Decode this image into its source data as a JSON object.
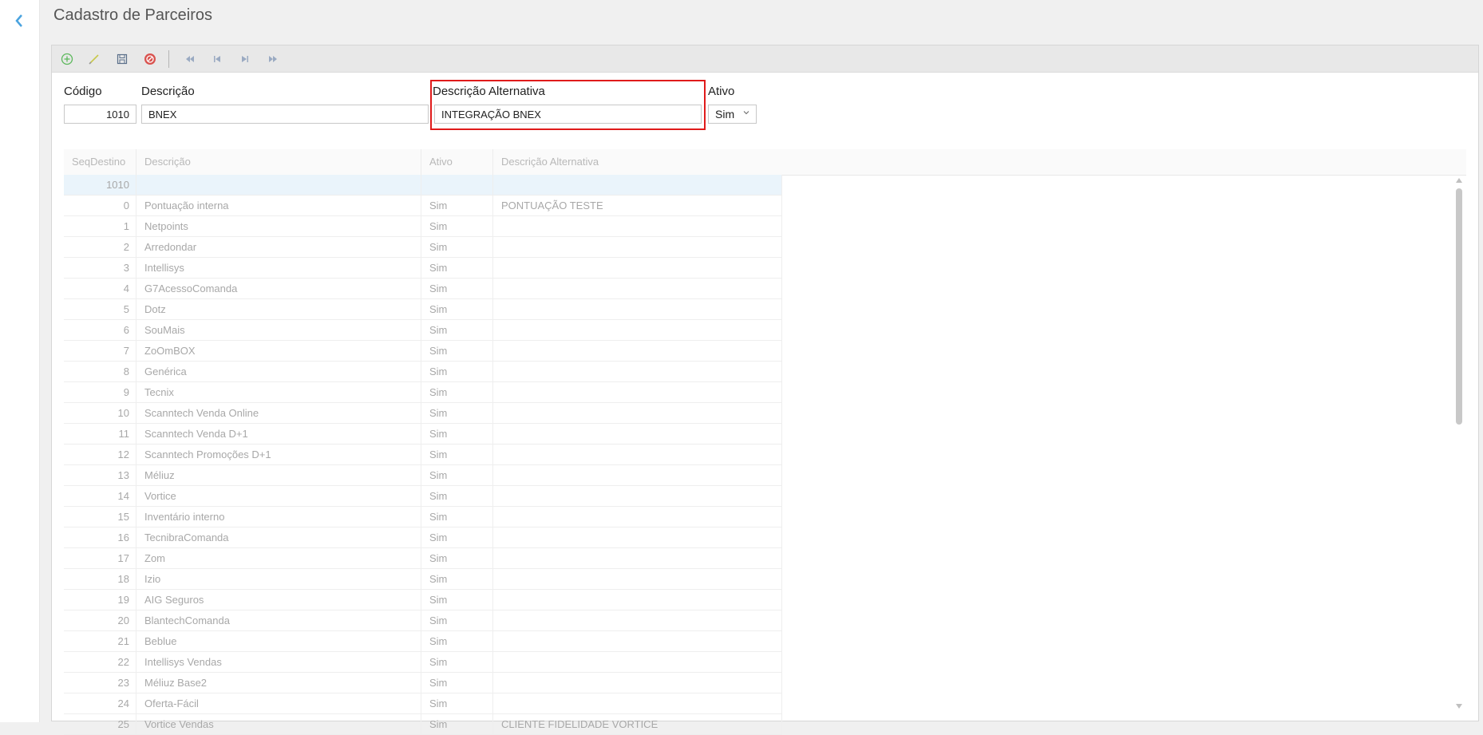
{
  "page": {
    "title": "Cadastro de Parceiros"
  },
  "icons": {
    "back": "chevron-left-icon",
    "toolbar": [
      "add-icon",
      "edit-icon",
      "save-icon",
      "cancel-icon",
      "first-icon",
      "previous-icon",
      "next-icon",
      "last-icon"
    ]
  },
  "colors": {
    "accent": "#4aa3df",
    "highlight": "#e01b1b",
    "add": "#5cb85c",
    "cancel": "#d9534f"
  },
  "form": {
    "codigo": {
      "label": "Código",
      "value": "1010"
    },
    "descricao": {
      "label": "Descrição",
      "value": "BNEX"
    },
    "descricao_alternativa": {
      "label": "Descrição Alternativa",
      "value": "INTEGRAÇÃO BNEX"
    },
    "ativo": {
      "label": "Ativo",
      "value": "Sim"
    }
  },
  "grid": {
    "columns": [
      "SeqDestino",
      "Descrição",
      "Ativo",
      "Descrição Alternativa"
    ],
    "rows": [
      {
        "seq": "1010",
        "desc": "",
        "ativo": "",
        "alt": ""
      },
      {
        "seq": "0",
        "desc": "Pontuação interna",
        "ativo": "Sim",
        "alt": "PONTUAÇÃO TESTE"
      },
      {
        "seq": "1",
        "desc": "Netpoints",
        "ativo": "Sim",
        "alt": ""
      },
      {
        "seq": "2",
        "desc": "Arredondar",
        "ativo": "Sim",
        "alt": ""
      },
      {
        "seq": "3",
        "desc": "Intellisys",
        "ativo": "Sim",
        "alt": ""
      },
      {
        "seq": "4",
        "desc": "G7AcessoComanda",
        "ativo": "Sim",
        "alt": ""
      },
      {
        "seq": "5",
        "desc": "Dotz",
        "ativo": "Sim",
        "alt": ""
      },
      {
        "seq": "6",
        "desc": "SouMais",
        "ativo": "Sim",
        "alt": ""
      },
      {
        "seq": "7",
        "desc": "ZoOmBOX",
        "ativo": "Sim",
        "alt": ""
      },
      {
        "seq": "8",
        "desc": "Genérica",
        "ativo": "Sim",
        "alt": ""
      },
      {
        "seq": "9",
        "desc": "Tecnix",
        "ativo": "Sim",
        "alt": ""
      },
      {
        "seq": "10",
        "desc": "Scanntech Venda Online",
        "ativo": "Sim",
        "alt": ""
      },
      {
        "seq": "11",
        "desc": "Scanntech Venda D+1",
        "ativo": "Sim",
        "alt": ""
      },
      {
        "seq": "12",
        "desc": "Scanntech Promoções D+1",
        "ativo": "Sim",
        "alt": ""
      },
      {
        "seq": "13",
        "desc": "Méliuz",
        "ativo": "Sim",
        "alt": ""
      },
      {
        "seq": "14",
        "desc": "Vortice",
        "ativo": "Sim",
        "alt": ""
      },
      {
        "seq": "15",
        "desc": "Inventário interno",
        "ativo": "Sim",
        "alt": ""
      },
      {
        "seq": "16",
        "desc": "TecnibraComanda",
        "ativo": "Sim",
        "alt": ""
      },
      {
        "seq": "17",
        "desc": "Zom",
        "ativo": "Sim",
        "alt": ""
      },
      {
        "seq": "18",
        "desc": "Izio",
        "ativo": "Sim",
        "alt": ""
      },
      {
        "seq": "19",
        "desc": "AIG Seguros",
        "ativo": "Sim",
        "alt": ""
      },
      {
        "seq": "20",
        "desc": "BlantechComanda",
        "ativo": "Sim",
        "alt": ""
      },
      {
        "seq": "21",
        "desc": "Beblue",
        "ativo": "Sim",
        "alt": ""
      },
      {
        "seq": "22",
        "desc": "Intellisys Vendas",
        "ativo": "Sim",
        "alt": ""
      },
      {
        "seq": "23",
        "desc": "Méliuz Base2",
        "ativo": "Sim",
        "alt": ""
      },
      {
        "seq": "24",
        "desc": "Oferta-Fácil",
        "ativo": "Sim",
        "alt": ""
      },
      {
        "seq": "25",
        "desc": "Vortice Vendas",
        "ativo": "Sim",
        "alt": "CLIENTE FIDELIDADE VORTICE"
      }
    ]
  }
}
